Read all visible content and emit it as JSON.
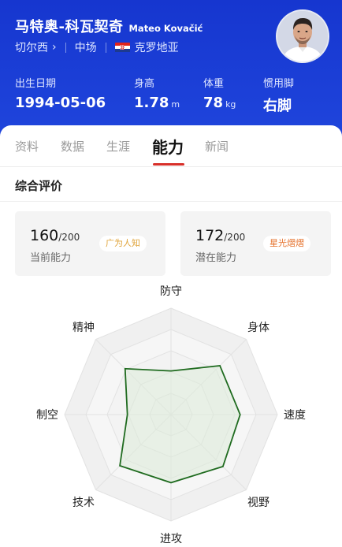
{
  "player": {
    "cn_name": "马特奥-科瓦契奇",
    "en_name": "Mateo Kovačić",
    "club": "切尔西",
    "position": "中场",
    "nationality": "克罗地亚"
  },
  "stats": [
    {
      "label": "出生日期",
      "value": "1994-05-06",
      "unit": ""
    },
    {
      "label": "身高",
      "value": "1.78",
      "unit": "m"
    },
    {
      "label": "体重",
      "value": "78",
      "unit": "kg"
    },
    {
      "label": "惯用脚",
      "value": "右脚",
      "unit": ""
    }
  ],
  "tabs": [
    "资料",
    "数据",
    "生涯",
    "能力",
    "新闻"
  ],
  "active_tab": "能力",
  "section_title": "综合评价",
  "current": {
    "score": "160",
    "max": "/200",
    "label": "当前能力",
    "badge": "广为人知",
    "badge_color": "#e0a43a"
  },
  "potential": {
    "score": "172",
    "max": "/200",
    "label": "潜在能力",
    "badge": "星光熠熠",
    "badge_color": "#e5702a"
  },
  "radar": {
    "axes": [
      "防守",
      "身体",
      "速度",
      "视野",
      "进攻",
      "技术",
      "制空",
      "精神"
    ],
    "values": [
      0.41,
      0.65,
      0.65,
      0.69,
      0.64,
      0.68,
      0.41,
      0.61
    ],
    "line_color": "#1f6b1f",
    "fill_color": "#dcebd8"
  },
  "colors": {
    "header": "#1a3fd0",
    "accent": "#d8302a"
  }
}
